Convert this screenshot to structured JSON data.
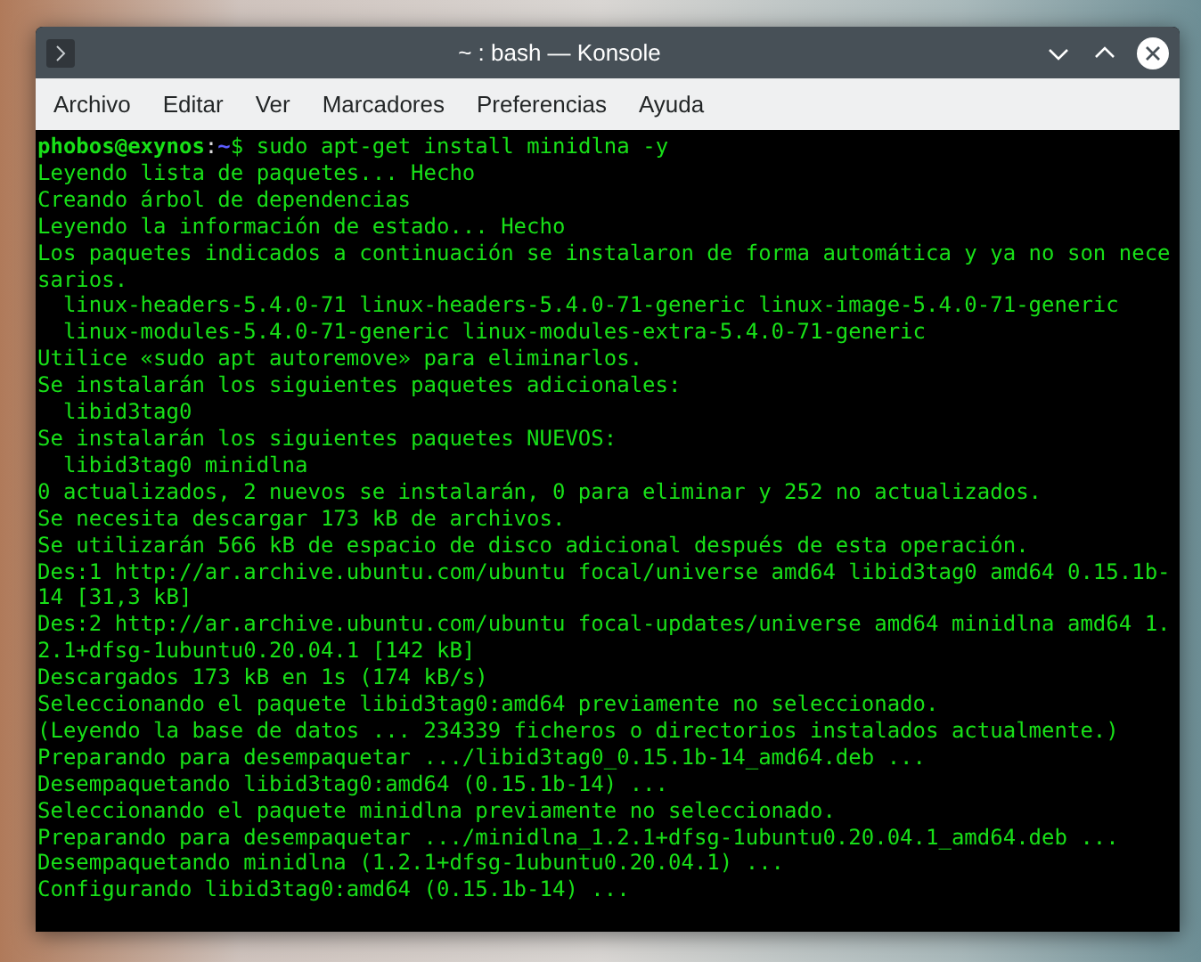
{
  "window": {
    "title": "~ : bash — Konsole"
  },
  "menu": [
    "Archivo",
    "Editar",
    "Ver",
    "Marcadores",
    "Preferencias",
    "Ayuda"
  ],
  "terminal": {
    "lines": [
      {
        "kind": "prompt",
        "user": "phobos@exynos",
        "separator": ":",
        "path": "~",
        "symbol": "$",
        "command": " sudo apt-get install minidlna -y"
      },
      {
        "kind": "output",
        "text": "Leyendo lista de paquetes... Hecho"
      },
      {
        "kind": "output",
        "text": "Creando árbol de dependencias"
      },
      {
        "kind": "output",
        "text": "Leyendo la información de estado... Hecho"
      },
      {
        "kind": "output",
        "text": "Los paquetes indicados a continuación se instalaron de forma automática y ya no son nece"
      },
      {
        "kind": "output",
        "text": "sarios."
      },
      {
        "kind": "output",
        "text": "  linux-headers-5.4.0-71 linux-headers-5.4.0-71-generic linux-image-5.4.0-71-generic"
      },
      {
        "kind": "output",
        "text": "  linux-modules-5.4.0-71-generic linux-modules-extra-5.4.0-71-generic"
      },
      {
        "kind": "output",
        "text": "Utilice «sudo apt autoremove» para eliminarlos."
      },
      {
        "kind": "output",
        "text": "Se instalarán los siguientes paquetes adicionales:"
      },
      {
        "kind": "output",
        "text": "  libid3tag0"
      },
      {
        "kind": "output",
        "text": "Se instalarán los siguientes paquetes NUEVOS:"
      },
      {
        "kind": "output",
        "text": "  libid3tag0 minidlna"
      },
      {
        "kind": "output",
        "text": "0 actualizados, 2 nuevos se instalarán, 0 para eliminar y 252 no actualizados."
      },
      {
        "kind": "output",
        "text": "Se necesita descargar 173 kB de archivos."
      },
      {
        "kind": "output",
        "text": "Se utilizarán 566 kB de espacio de disco adicional después de esta operación."
      },
      {
        "kind": "output",
        "text": "Des:1 http://ar.archive.ubuntu.com/ubuntu focal/universe amd64 libid3tag0 amd64 0.15.1b-"
      },
      {
        "kind": "output",
        "text": "14 [31,3 kB]"
      },
      {
        "kind": "output",
        "text": "Des:2 http://ar.archive.ubuntu.com/ubuntu focal-updates/universe amd64 minidlna amd64 1."
      },
      {
        "kind": "output",
        "text": "2.1+dfsg-1ubuntu0.20.04.1 [142 kB]"
      },
      {
        "kind": "output",
        "text": "Descargados 173 kB en 1s (174 kB/s)"
      },
      {
        "kind": "output",
        "text": "Seleccionando el paquete libid3tag0:amd64 previamente no seleccionado."
      },
      {
        "kind": "output",
        "text": "(Leyendo la base de datos ... 234339 ficheros o directorios instalados actualmente.)"
      },
      {
        "kind": "output",
        "text": "Preparando para desempaquetar .../libid3tag0_0.15.1b-14_amd64.deb ..."
      },
      {
        "kind": "output",
        "text": "Desempaquetando libid3tag0:amd64 (0.15.1b-14) ..."
      },
      {
        "kind": "output",
        "text": "Seleccionando el paquete minidlna previamente no seleccionado."
      },
      {
        "kind": "output",
        "text": "Preparando para desempaquetar .../minidlna_1.2.1+dfsg-1ubuntu0.20.04.1_amd64.deb ..."
      },
      {
        "kind": "output",
        "text": "Desempaquetando minidlna (1.2.1+dfsg-1ubuntu0.20.04.1) ..."
      },
      {
        "kind": "output",
        "text": "Configurando libid3tag0:amd64 (0.15.1b-14) ..."
      }
    ]
  }
}
